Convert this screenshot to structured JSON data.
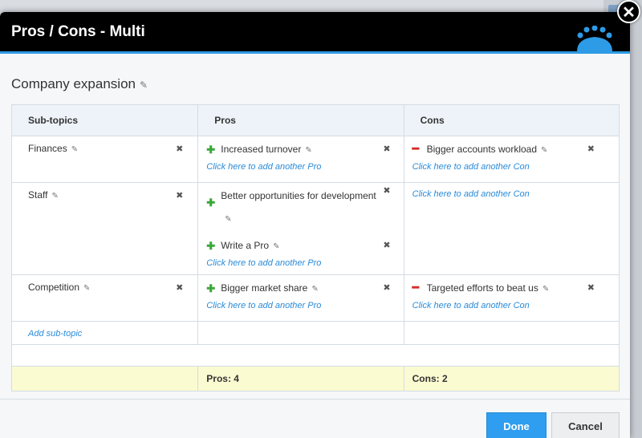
{
  "window": {
    "title": "Pros / Cons - Multi",
    "close_symbol": "✕"
  },
  "topic": {
    "title": "Company expansion"
  },
  "table": {
    "headers": {
      "subtopics": "Sub-topics",
      "pros": "Pros",
      "cons": "Cons"
    },
    "rows": [
      {
        "subtopic": "Finances",
        "pros": [
          "Increased turnover"
        ],
        "cons": [
          "Bigger accounts workload"
        ]
      },
      {
        "subtopic": "Staff",
        "pros": [
          "Better opportunities for development",
          "Write a Pro"
        ],
        "cons": []
      },
      {
        "subtopic": "Competition",
        "pros": [
          "Bigger market share"
        ],
        "cons": [
          "Targeted efforts to beat us"
        ]
      }
    ],
    "add_pro_label": "Click here to add another Pro",
    "add_con_label": "Click here to add another Con",
    "add_subtopic_label": "Add sub-topic",
    "totals": {
      "pros": "Pros: 4",
      "cons": "Cons: 2"
    }
  },
  "buttons": {
    "done": "Done",
    "cancel": "Cancel"
  },
  "icons": {
    "edit": "pencil-icon",
    "remove": "remove-x-icon",
    "pro": "plus-icon",
    "con": "minus-icon",
    "close": "close-icon"
  },
  "colors": {
    "accent": "#2e9be6",
    "pro_sign": "#3aa83a",
    "con_sign": "#d42d2d",
    "link": "#2a8bd8",
    "totals_bg": "#fbfbd2"
  }
}
